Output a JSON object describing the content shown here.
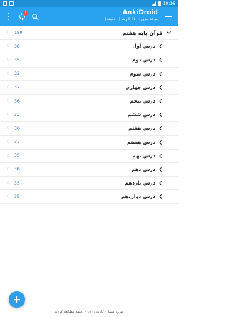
{
  "status_bar": {
    "time": "10:16"
  },
  "app_bar": {
    "title": "AnkiDroid",
    "subtitle": "موعد مرور: ۱۵۰ کارت (۰ دقیقه)",
    "sync_badge": "!"
  },
  "decks": [
    {
      "name": "قرآن پایه هفتم",
      "count": "150",
      "top": true
    },
    {
      "name": "درس اول",
      "count": "38"
    },
    {
      "name": "درس دوم",
      "count": "35"
    },
    {
      "name": "درس سوم",
      "count": "32"
    },
    {
      "name": "درس چهارم",
      "count": "32"
    },
    {
      "name": "درس پنجم",
      "count": "36"
    },
    {
      "name": "درس ششم",
      "count": "32"
    },
    {
      "name": "درس هفتم",
      "count": "36"
    },
    {
      "name": "درس هشتم",
      "count": "37"
    },
    {
      "name": "درس نهم",
      "count": "35"
    },
    {
      "name": "درس دهم",
      "count": "36"
    },
    {
      "name": "درس یازدهم",
      "count": "35"
    },
    {
      "name": "درس دوازدهم",
      "count": "35"
    }
  ],
  "fab_label": "+",
  "footer": "امروز شما ۰ کارت را در ۰ دقیقه مطالعه کردید",
  "colors": {
    "status_bar": "#1e8fd6",
    "app_bar": "#29a3f0",
    "due_count": "#1f6dd3",
    "fab": "#2f9ee9"
  }
}
